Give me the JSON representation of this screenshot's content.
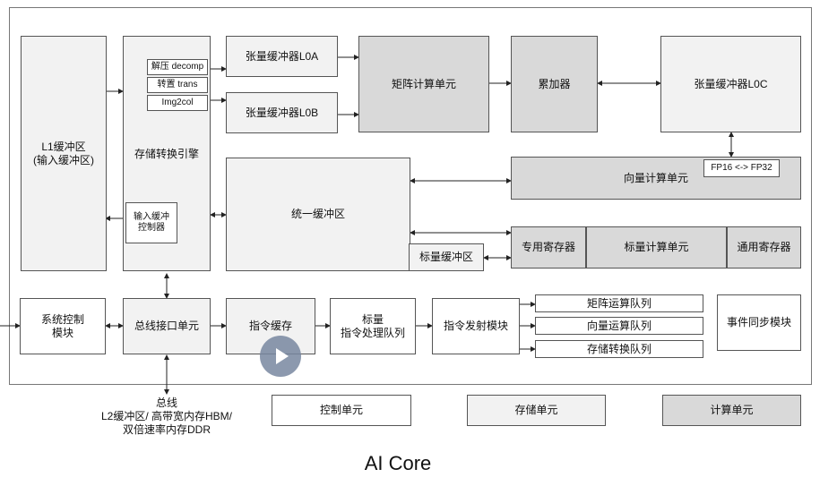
{
  "modules": {
    "l1": "L1缓冲区\n(输入缓冲区)",
    "mte": "存储转换引擎",
    "decomp": "解压 decomp",
    "trans": "转置 trans",
    "img2col": "Img2col",
    "input_ctrl": "输入缓冲\n控制器",
    "l0a": "张量缓冲器L0A",
    "l0b": "张量缓冲器L0B",
    "cube": "矩阵计算单元",
    "accum": "累加器",
    "l0c": "张量缓冲器L0C",
    "vector": "向量计算单元",
    "fp": "FP16 <-> FP32",
    "ub": "统一缓冲区",
    "scalar_buf": "标量缓冲区",
    "spr": "专用寄存器",
    "scalar": "标量计算单元",
    "gpr": "通用寄存器",
    "sys_ctrl": "系统控制\n模块",
    "biu": "总线接口单元",
    "icache": "指令缓存",
    "scalar_queue": "标量\n指令处理队列",
    "dispatch": "指令发射模块",
    "cube_queue": "矩阵运算队列",
    "vector_queue": "向量运算队列",
    "mte_queue": "存储转换队列",
    "event_sync": "事件同步模块"
  },
  "bus_label": "总线\nL2缓冲区/ 高带宽内存HBM/\n双倍速率内存DDR",
  "legend": {
    "control": "控制单元",
    "storage": "存储单元",
    "compute": "计算单元"
  },
  "caption": "AI Core",
  "colors": {
    "storage": "#f2f2f2",
    "compute": "#d9d9d9",
    "control": "#ffffff",
    "play": "#7887a0"
  }
}
